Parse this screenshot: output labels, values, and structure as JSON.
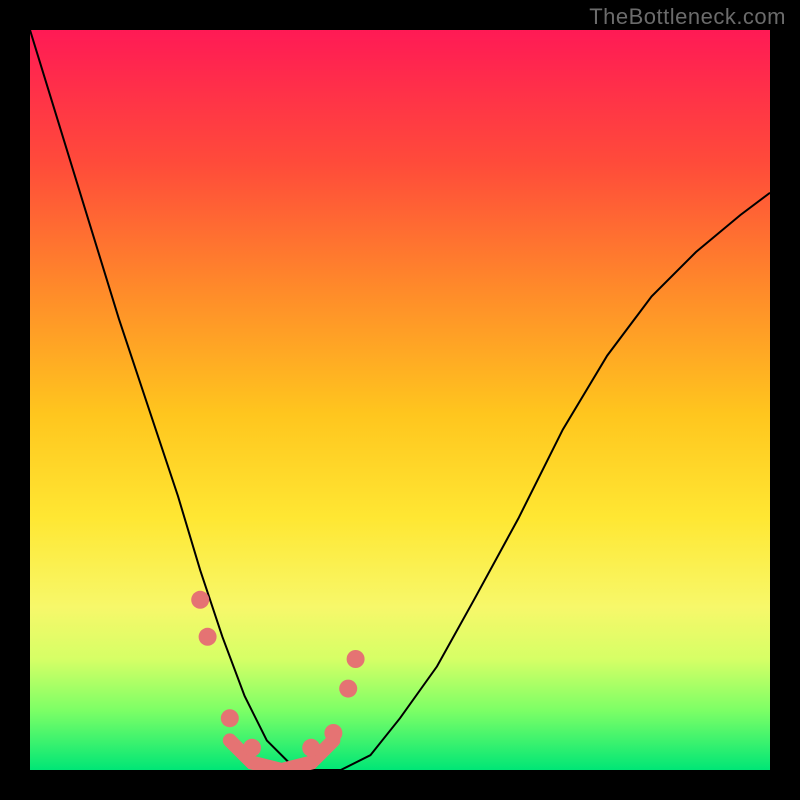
{
  "watermark": "TheBottleneck.com",
  "chart_data": {
    "type": "line",
    "title": "",
    "xlabel": "",
    "ylabel": "",
    "xlim": [
      0,
      100
    ],
    "ylim": [
      0,
      100
    ],
    "grid": false,
    "legend": false,
    "x": [
      0,
      4,
      8,
      12,
      16,
      20,
      23,
      26,
      29,
      32,
      35,
      38,
      42,
      46,
      50,
      55,
      60,
      66,
      72,
      78,
      84,
      90,
      96,
      100
    ],
    "values": [
      100,
      87,
      74,
      61,
      49,
      37,
      27,
      18,
      10,
      4,
      1,
      0,
      0,
      2,
      7,
      14,
      23,
      34,
      46,
      56,
      64,
      70,
      75,
      78
    ],
    "markers": {
      "dots": [
        {
          "x": 23,
          "y": 23
        },
        {
          "x": 24,
          "y": 18
        },
        {
          "x": 27,
          "y": 7
        },
        {
          "x": 30,
          "y": 3
        },
        {
          "x": 38,
          "y": 3
        },
        {
          "x": 41,
          "y": 5
        },
        {
          "x": 43,
          "y": 11
        },
        {
          "x": 44,
          "y": 15
        }
      ],
      "baseline_path": [
        {
          "x": 27,
          "y": 4
        },
        {
          "x": 30,
          "y": 1
        },
        {
          "x": 34,
          "y": 0
        },
        {
          "x": 38,
          "y": 1
        },
        {
          "x": 41,
          "y": 4
        }
      ]
    },
    "colors": {
      "curve": "#000000",
      "markers": "#e57373",
      "gradient_top": "#ff1a55",
      "gradient_bottom": "#00e676"
    }
  }
}
